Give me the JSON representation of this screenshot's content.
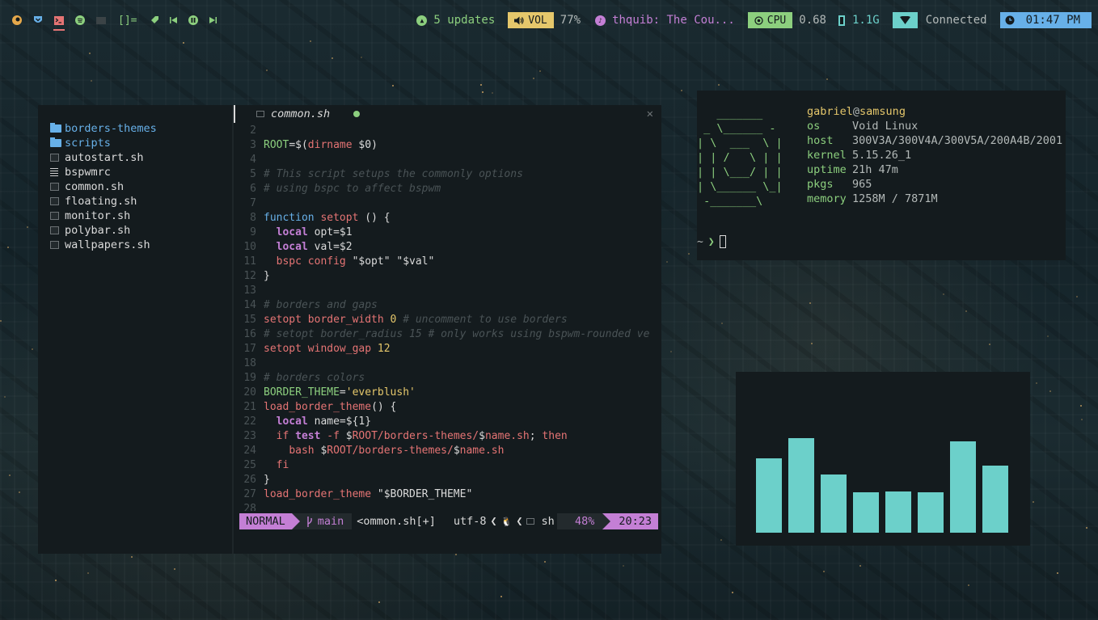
{
  "topbar": {
    "workspaces": [
      {
        "name": "firefox",
        "color": "#e5a84b",
        "active": false
      },
      {
        "name": "shield",
        "color": "#67b0e8",
        "active": false
      },
      {
        "name": "terminal",
        "color": "#e57474",
        "active": true
      },
      {
        "name": "spotify",
        "color": "#8ccf7e",
        "active": false
      },
      {
        "name": "folder",
        "color": "#3b4346",
        "active": false
      }
    ],
    "layout_label": "[]=",
    "updates_label": "5 updates",
    "volume_label": "VOL",
    "volume_value": "77%",
    "music_label": "thquib: The Cou...",
    "cpu_label": "CPU",
    "cpu_value": "0.68",
    "mem_value": "1.1G",
    "network_label": "Connected",
    "time": "01:47 PM",
    "colors": {
      "green": "#8ccf7e",
      "yellow": "#e5c76b",
      "purple": "#c47fd5",
      "cyan": "#6cd0ca",
      "blue": "#67b0e8"
    }
  },
  "tree": {
    "items": [
      {
        "label": "borders-themes",
        "type": "folder"
      },
      {
        "label": "scripts",
        "type": "folder"
      },
      {
        "label": "autostart.sh",
        "type": "file"
      },
      {
        "label": "bspwmrc",
        "type": "config"
      },
      {
        "label": "common.sh",
        "type": "file"
      },
      {
        "label": "floating.sh",
        "type": "file"
      },
      {
        "label": "monitor.sh",
        "type": "file"
      },
      {
        "label": "polybar.sh",
        "type": "file"
      },
      {
        "label": "wallpapers.sh",
        "type": "file"
      }
    ]
  },
  "editor": {
    "tab_name": "common.sh",
    "lines": [
      {
        "n": "2",
        "t": []
      },
      {
        "n": "3",
        "t": [
          [
            "v",
            "ROOT"
          ],
          [
            "x",
            "=$("
          ],
          [
            "f",
            "dirname"
          ],
          [
            "x",
            " $0)"
          ]
        ]
      },
      {
        "n": "4",
        "t": []
      },
      {
        "n": "5",
        "t": [
          [
            "c",
            "# This script setups the commonly options"
          ]
        ]
      },
      {
        "n": "6",
        "t": [
          [
            "c",
            "# using bspc to affect bspwm"
          ]
        ]
      },
      {
        "n": "7",
        "t": []
      },
      {
        "n": "8",
        "t": [
          [
            "k",
            "function"
          ],
          [
            "x",
            " "
          ],
          [
            "f",
            "setopt"
          ],
          [
            "x",
            " () {"
          ]
        ]
      },
      {
        "n": "9",
        "t": [
          [
            "x",
            "  "
          ],
          [
            "l",
            "local"
          ],
          [
            "x",
            " opt=$1"
          ]
        ]
      },
      {
        "n": "10",
        "t": [
          [
            "x",
            "  "
          ],
          [
            "l",
            "local"
          ],
          [
            "x",
            " val=$2"
          ]
        ]
      },
      {
        "n": "11",
        "t": [
          [
            "x",
            "  "
          ],
          [
            "f",
            "bspc config"
          ],
          [
            "x",
            " \"$opt\" \"$val\""
          ]
        ]
      },
      {
        "n": "12",
        "t": [
          [
            "x",
            "}"
          ]
        ]
      },
      {
        "n": "13",
        "t": []
      },
      {
        "n": "14",
        "t": [
          [
            "c",
            "# borders and gaps"
          ]
        ]
      },
      {
        "n": "15",
        "t": [
          [
            "f",
            "setopt border_width"
          ],
          [
            "x",
            " "
          ],
          [
            "d",
            "0"
          ],
          [
            "x",
            " "
          ],
          [
            "c",
            "# uncomment to use borders"
          ]
        ]
      },
      {
        "n": "16",
        "t": [
          [
            "c",
            "# setopt border_radius 15 # only works using bspwm-rounded ve"
          ]
        ]
      },
      {
        "n": "17",
        "t": [
          [
            "f",
            "setopt window_gap"
          ],
          [
            "x",
            " "
          ],
          [
            "d",
            "12"
          ]
        ]
      },
      {
        "n": "18",
        "t": []
      },
      {
        "n": "19",
        "t": [
          [
            "c",
            "# borders colors"
          ]
        ]
      },
      {
        "n": "20",
        "t": [
          [
            "v",
            "BORDER_THEME"
          ],
          [
            "x",
            "="
          ],
          [
            "q",
            "'everblush'"
          ]
        ]
      },
      {
        "n": "21",
        "t": [
          [
            "f",
            "load_border_theme"
          ],
          [
            "x",
            "() {"
          ]
        ]
      },
      {
        "n": "22",
        "t": [
          [
            "x",
            "  "
          ],
          [
            "l",
            "local"
          ],
          [
            "x",
            " name=${1}"
          ]
        ]
      },
      {
        "n": "23",
        "t": [
          [
            "x",
            "  "
          ],
          [
            "f",
            "if"
          ],
          [
            "x",
            " "
          ],
          [
            "l",
            "test"
          ],
          [
            "x",
            " "
          ],
          [
            "f",
            "-f"
          ],
          [
            "x",
            " $"
          ],
          [
            "f",
            "ROOT"
          ],
          [
            "f",
            "/borders-themes/"
          ],
          [
            "x",
            "$"
          ],
          [
            "f",
            "name.sh"
          ],
          [
            "x",
            "; "
          ],
          [
            "f",
            "then"
          ]
        ]
      },
      {
        "n": "24",
        "t": [
          [
            "x",
            "    "
          ],
          [
            "f",
            "bash"
          ],
          [
            "x",
            " $"
          ],
          [
            "f",
            "ROOT"
          ],
          [
            "f",
            "/borders-themes/"
          ],
          [
            "x",
            "$"
          ],
          [
            "f",
            "name.sh"
          ]
        ]
      },
      {
        "n": "25",
        "t": [
          [
            "x",
            "  "
          ],
          [
            "f",
            "fi"
          ]
        ]
      },
      {
        "n": "26",
        "t": [
          [
            "x",
            "}"
          ]
        ]
      },
      {
        "n": "27",
        "t": [
          [
            "f",
            "load_border_theme"
          ],
          [
            "x",
            " \"$BORDER_THEME\""
          ]
        ]
      },
      {
        "n": "28",
        "t": []
      }
    ],
    "status": {
      "mode": "NORMAL",
      "branch": "main",
      "file": "<ommon.sh[+]",
      "encoding": "utf-8",
      "sep1": "❮",
      "os_icon": "🐧",
      "sep2": "❮",
      "filetype": "sh",
      "percent": "48%",
      "position": "20:23"
    }
  },
  "fetch": {
    "ascii": "   _______\n _ \\______ -\n| \\  ___  \\ |\n| | /   \\ | |\n| | \\___/ | |\n| \\______ \\_|\n -_______\\",
    "user": "gabriel",
    "at": "@",
    "host": "samsung",
    "rows": [
      {
        "key": "os",
        "value": "Void Linux"
      },
      {
        "key": "host",
        "value": "300V3A/300V4A/300V5A/200A4B/2001"
      },
      {
        "key": "kernel",
        "value": "5.15.26_1"
      },
      {
        "key": "uptime",
        "value": "21h 47m"
      },
      {
        "key": "pkgs",
        "value": "965"
      },
      {
        "key": "memory",
        "value": "1258M / 7871M"
      }
    ],
    "prompt_tilde": "~",
    "prompt_arrow": "❯"
  },
  "visualizer": {
    "levels": [
      0.61,
      0.78,
      0.48,
      0.33,
      0.34,
      0.33,
      0.75,
      0.55
    ],
    "color": "#6cd0ca"
  }
}
